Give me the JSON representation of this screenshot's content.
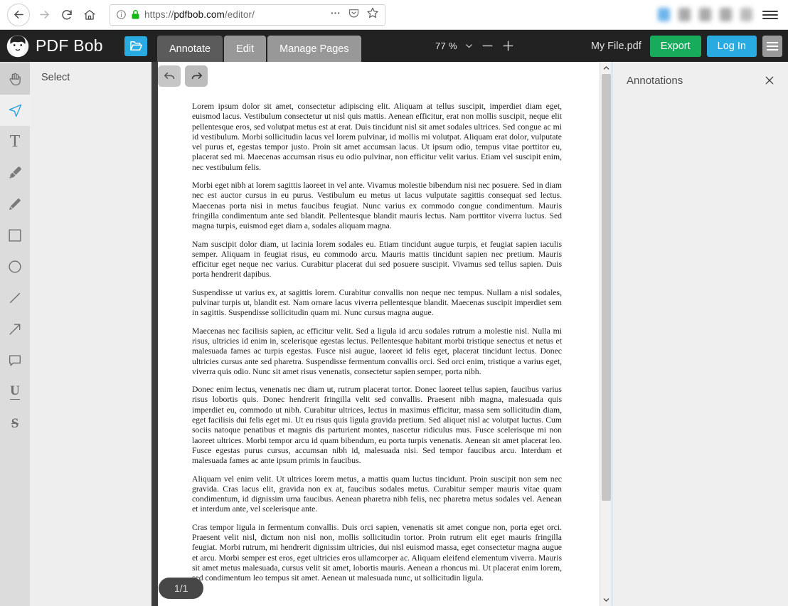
{
  "browser": {
    "back_icon": "arrow-left-icon",
    "forward_icon": "arrow-right-icon",
    "reload_icon": "reload-icon",
    "home_icon": "home-icon",
    "info_icon": "page-info-icon",
    "lock_icon": "padlock-icon",
    "url_scheme": "https://",
    "url_host": "pdfbob.com",
    "url_path": "/editor/",
    "url_full": "https://pdfbob.com/editor/",
    "more_icon": "ellipsis-icon",
    "pocket_icon": "pocket-icon",
    "bookmark_icon": "star-icon",
    "menu_icon": "hamburger-icon",
    "extension_colors": [
      "#55a8e8",
      "#9b9b9b",
      "#9b9b9b",
      "#9b9b9b",
      "#b0b0b0"
    ]
  },
  "header": {
    "logo_icon": "pdfbob-beard-logo",
    "brand": "PDF Bob",
    "open_file_icon": "open-folder-icon",
    "tabs": [
      {
        "label": "Annotate",
        "active": true
      },
      {
        "label": "Edit",
        "active": false
      },
      {
        "label": "Manage Pages",
        "active": false
      }
    ],
    "zoom": {
      "value": "77 %",
      "dropdown_icon": "chevron-down-icon",
      "zoom_out_icon": "minus-icon",
      "zoom_in_icon": "plus-icon"
    },
    "file_name": "My File.pdf",
    "export_label": "Export",
    "login_label": "Log In",
    "menu_icon": "hamburger-icon",
    "colors": {
      "bar": "#222222",
      "accent_blue": "#29abe2",
      "export_green": "#17ab5b",
      "tab_active": "#5b5b5b",
      "tab_inactive": "#989898"
    }
  },
  "toolbar": {
    "tools": [
      {
        "name": "pan-hand-tool",
        "icon": "hand-icon",
        "active": false,
        "hover": true
      },
      {
        "name": "select-tool",
        "icon": "cursor-arrow-icon",
        "active": true,
        "hover": false
      },
      {
        "name": "text-tool",
        "icon": "text-t-icon",
        "active": false,
        "hover": false
      },
      {
        "name": "highlighter-tool",
        "icon": "highlighter-icon",
        "active": false,
        "hover": false
      },
      {
        "name": "pencil-tool",
        "icon": "pencil-icon",
        "active": false,
        "hover": false
      },
      {
        "name": "rectangle-tool",
        "icon": "square-icon",
        "active": false,
        "hover": false
      },
      {
        "name": "ellipse-tool",
        "icon": "circle-icon",
        "active": false,
        "hover": false
      },
      {
        "name": "line-tool",
        "icon": "line-icon",
        "active": false,
        "hover": false
      },
      {
        "name": "arrow-tool",
        "icon": "arrow-icon",
        "active": false,
        "hover": false
      },
      {
        "name": "comment-tool",
        "icon": "speech-bubble-icon",
        "active": false,
        "hover": false
      },
      {
        "name": "underline-tool",
        "icon": "underline-u-icon",
        "active": false,
        "hover": false
      },
      {
        "name": "strikethrough-tool",
        "icon": "strikethrough-s-icon",
        "active": false,
        "hover": false
      }
    ],
    "option_label": "Select"
  },
  "document": {
    "undo_icon": "undo-arrow-icon",
    "redo_icon": "redo-arrow-icon",
    "page_indicator": "1/1",
    "paragraphs": [
      "Lorem ipsum dolor sit amet, consectetur adipiscing elit. Aliquam at tellus suscipit, imperdiet diam eget, euismod lacus. Vestibulum consectetur ut nisl quis mattis. Aenean efficitur, erat non mollis suscipit, neque elit pellentesque eros, sed volutpat metus est at erat. Duis tincidunt nisl sit amet sodales ultrices. Sed congue ac mi id vestibulum. Morbi sollicitudin lacus vel lorem pulvinar, id mollis mi volutpat. Aliquam erat dolor, vulputate vel purus et, egestas tempor justo. Proin sit amet accumsan lacus. Ut ipsum odio, tempus vitae porttitor eu, placerat sed mi. Maecenas accumsan risus eu odio pulvinar, non efficitur velit varius. Etiam vel suscipit enim, nec vestibulum felis.",
      "Morbi eget nibh at lorem sagittis laoreet in vel ante. Vivamus molestie bibendum nisi nec posuere. Sed in diam nec est auctor cursus in eu purus. Vestibulum eu metus ut lacus vulputate sagittis consequat sed lectus. Maecenas porta nisi in metus faucibus feugiat. Nunc varius ex commodo congue condimentum. Mauris fringilla condimentum ante sed blandit. Pellentesque blandit mauris lectus. Nam porttitor viverra luctus. Sed magna turpis, euismod eget diam a, sodales aliquam magna.",
      "Nam suscipit dolor diam, ut lacinia lorem sodales eu. Etiam tincidunt augue turpis, et feugiat sapien iaculis semper. Aliquam in feugiat risus, eu commodo arcu. Mauris mattis tincidunt sapien nec pretium. Mauris efficitur eget neque nec varius. Curabitur placerat dui sed posuere suscipit. Vivamus sed tellus sapien. Duis porta hendrerit dapibus.",
      "Suspendisse ut varius ex, at sagittis lorem. Curabitur convallis non neque nec tempus. Nullam a nisl sodales, pulvinar turpis ut, blandit est. Nam ornare lacus viverra pellentesque blandit. Maecenas suscipit imperdiet sem in sagittis. Suspendisse sollicitudin quam mi. Nunc cursus magna augue.",
      "Maecenas nec facilisis sapien, ac efficitur velit. Sed a ligula id arcu sodales rutrum a molestie nisl. Nulla mi risus, ultricies id enim in, scelerisque egestas lectus. Pellentesque habitant morbi tristique senectus et netus et malesuada fames ac turpis egestas. Fusce nisi augue, laoreet id felis eget, placerat tincidunt lectus. Donec ultricies cursus ante sed pharetra. Suspendisse fermentum convallis orci. Sed orci enim, tristique a varius eget, viverra quis odio. Nunc sit amet risus venenatis, consectetur sapien semper, porta nibh.",
      "Donec enim lectus, venenatis nec diam ut, rutrum placerat tortor. Donec laoreet tellus sapien, faucibus varius risus lobortis quis. Donec hendrerit fringilla velit sed convallis. Praesent nibh magna, malesuada quis imperdiet eu, commodo ut nibh. Curabitur ultrices, lectus in maximus efficitur, massa sem sollicitudin diam, eget facilisis dui felis eget mi. Ut eu risus quis ligula gravida pretium. Sed aliquet nisl ac volutpat luctus. Cum sociis natoque penatibus et magnis dis parturient montes, nascetur ridiculus mus. Fusce scelerisque mi non laoreet ultrices. Morbi tempor arcu id quam bibendum, eu porta turpis venenatis. Aenean sit amet placerat leo. Fusce egestas purus cursus, accumsan nibh id, malesuada nisi. Sed tempor faucibus arcu. Interdum et malesuada fames ac ante ipsum primis in faucibus.",
      "Aliquam vel enim velit. Ut ultrices lorem metus, a mattis quam luctus tincidunt. Proin suscipit non sem nec gravida. Cras lacus elit, gravida non ex at, faucibus sodales metus. Curabitur semper mauris vitae quam condimentum, id dignissim urna faucibus. Aenean pharetra nibh felis, nec pharetra metus sodales vel. Aenean et interdum ante, vel scelerisque ante.",
      "Cras tempor ligula in fermentum convallis. Duis orci sapien, venenatis sit amet congue non, porta eget orci. Praesent velit nisl, dictum non nisl non, mollis sollicitudin tortor. Proin rutrum elit eget mauris fringilla feugiat. Morbi rutrum, mi hendrerit dignissim ultricies, dui nisl euismod massa, eget consectetur magna augue et arcu. Morbi semper est eros, eget ultricies eros ullamcorper ac. Aliquam eleifend elementum viverra. Mauris sit amet metus malesuada, cursus velit sit amet, lobortis mauris. Aenean a rhoncus mi. Ut placerat enim lorem, sed condimentum leo tempus sit amet. Aenean ut malesuada nunc, ut sollicitudin ligula."
    ],
    "scrollbar": {
      "up_icon": "chevron-up-icon",
      "down_icon": "chevron-down-icon"
    }
  },
  "annotations_panel": {
    "title": "Annotations",
    "close_icon": "close-x-icon",
    "items": []
  }
}
